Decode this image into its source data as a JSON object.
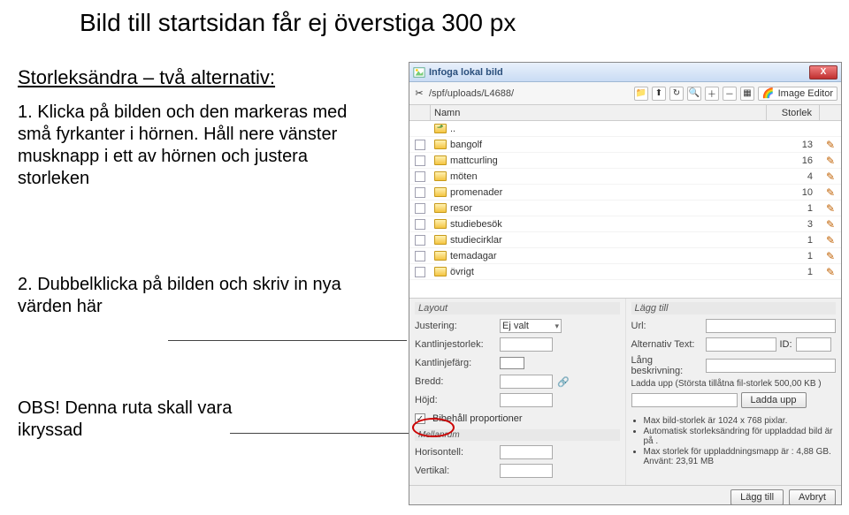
{
  "doc": {
    "title": "Bild till startsidan får ej överstiga 300 px",
    "subtitle": "Storleksändra – två alternativ:",
    "step1": "1. Klicka på bilden och den markeras med små fyrkanter i hörnen. Håll nere vänster musknapp i ett av hörnen och justera storleken",
    "step2": "2. Dubbelklicka på bilden och skriv in nya värden  här",
    "obs": "OBS! Denna ruta skall vara ikryssad"
  },
  "dialog": {
    "title": "Infoga lokal bild",
    "close": "X",
    "path": "/spf/uploads/L4688/",
    "image_editor": "Image Editor",
    "cols": {
      "name": "Namn",
      "size": "Storlek"
    },
    "files": [
      {
        "name": "..",
        "up": true,
        "size": ""
      },
      {
        "name": "bangolf",
        "size": "13"
      },
      {
        "name": "mattcurling",
        "size": "16"
      },
      {
        "name": "möten",
        "size": "4"
      },
      {
        "name": "promenader",
        "size": "10"
      },
      {
        "name": "resor",
        "size": "1"
      },
      {
        "name": "studiebesök",
        "size": "3"
      },
      {
        "name": "studiecirklar",
        "size": "1"
      },
      {
        "name": "temadagar",
        "size": "1"
      },
      {
        "name": "övrigt",
        "size": "1"
      }
    ],
    "layout_hdr": "Layout",
    "add_hdr": "Lägg till",
    "labels": {
      "justering": "Justering:",
      "justering_val": "Ej valt",
      "kantlinjestorlek": "Kantlinjestorlek:",
      "kantlinjefarg": "Kantlinjefärg:",
      "bredd": "Bredd:",
      "hojd": "Höjd:",
      "bibehall": "Bibehåll proportioner",
      "mellanrum": "Mellanrum",
      "horisontell": "Horisontell:",
      "vertikal": "Vertikal:",
      "url": "Url:",
      "altext": "Alternativ Text:",
      "id": "ID:",
      "langbeskr": "Lång beskrivning:"
    },
    "upload_note": "Ladda upp (Största tillåtna fil-storlek 500,00 KB )",
    "upload_btn": "Ladda upp",
    "bullets": [
      "Max bild-storlek är 1024 x 768 pixlar.",
      "Automatisk storleksändring för uppladdad bild är på .",
      "Max storlek för uppladdningsmapp är : 4,88 GB. Använt: 23,91 MB"
    ],
    "add_btn": "Lägg till",
    "cancel_btn": "Avbryt"
  }
}
